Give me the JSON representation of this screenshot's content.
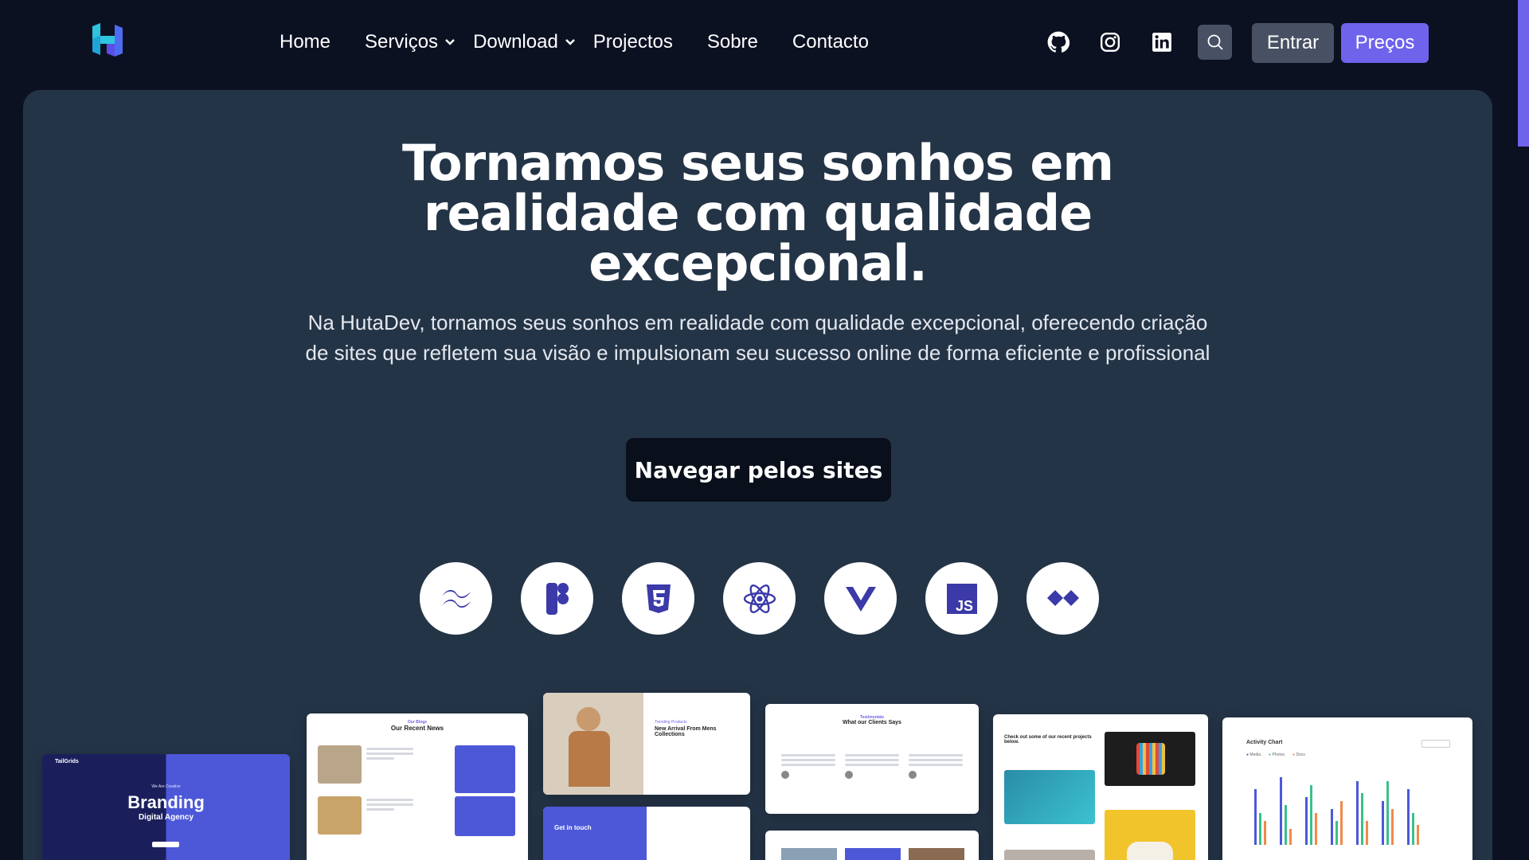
{
  "nav": {
    "logo_icon": "hutadev-logo-icon",
    "items": [
      {
        "label": "Home"
      },
      {
        "label": "Serviços",
        "dropdown": true
      },
      {
        "label": "Download",
        "dropdown": true
      },
      {
        "label": "Projectos"
      },
      {
        "label": "Sobre"
      },
      {
        "label": "Contacto"
      }
    ],
    "socials": [
      "github-icon",
      "instagram-icon",
      "linkedin-icon"
    ],
    "search_icon": "search-icon",
    "login_label": "Entrar",
    "pricing_label": "Preços"
  },
  "hero": {
    "title_lines": [
      "Tornamos seus sonhos em",
      "realidade com qualidade",
      "excepcional."
    ],
    "subtitle": "Na HutaDev, tornamos seus sonhos em realidade com qualidade excepcional, oferecendo criação de sites que refletem sua visão e impulsionam seu sucesso online de forma eficiente e profissional",
    "cta_label": "Navegar pelos sites"
  },
  "technologies": [
    "tailwind-icon",
    "figma-icon",
    "html5-icon",
    "react-icon",
    "vue-icon",
    "javascript-icon",
    "alpine-icon"
  ],
  "previews": {
    "branding": {
      "brand": "TailGrids",
      "kicker": "We Are Creative",
      "title": "Branding",
      "subtitle": "Digital Agency"
    },
    "news": {
      "kicker": "Our Blogs",
      "title": "Our Recent News"
    },
    "fashion": {
      "kicker": "Trending Products",
      "title": "New Arrival From Mens Collections",
      "contact": "Get in touch"
    },
    "testimonials": {
      "kicker": "Testimonials",
      "title": "What our Clients Says"
    },
    "projects": {
      "title": "Check out some of our recent projects below."
    },
    "activity": {
      "title": "Activity Chart",
      "legend": [
        "Media",
        "Photos",
        "Docs"
      ]
    }
  },
  "colors": {
    "accent": "#6f63ec",
    "background": "#0c1122",
    "hero": "#243447",
    "tech_icon": "#3b3aa8"
  }
}
